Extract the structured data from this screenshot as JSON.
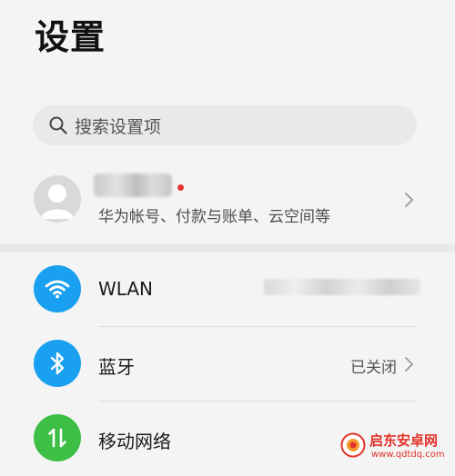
{
  "header": {
    "title": "设置"
  },
  "search": {
    "placeholder": "搜索设置项",
    "icon": "search-icon"
  },
  "account": {
    "subtitle": "华为帐号、付款与账单、云空间等",
    "notification_color": "#e8322f"
  },
  "settings": [
    {
      "label": "WLAN",
      "icon": "wifi-icon",
      "color": "#1aa0f0"
    },
    {
      "label": "蓝牙",
      "icon": "bluetooth-icon",
      "color": "#1aa0f0",
      "value": "已关闭"
    },
    {
      "label": "移动网络",
      "icon": "mobile-network-icon",
      "color": "#3dbe45"
    }
  ],
  "watermark": {
    "title": "启东安卓网",
    "url": "www.qdtdq.com"
  }
}
